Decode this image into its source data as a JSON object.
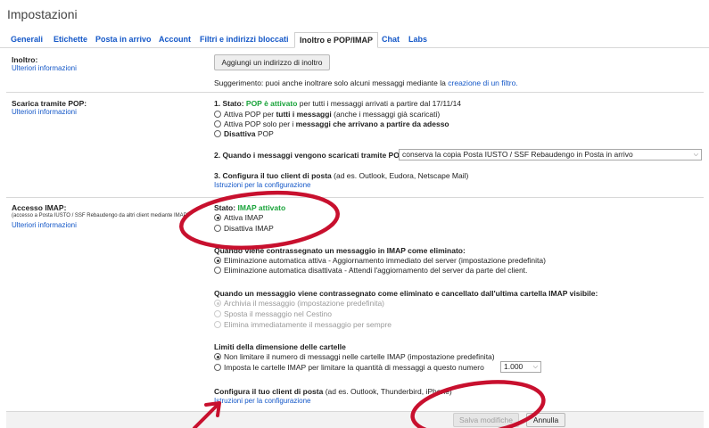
{
  "title": "Impostazioni",
  "tabs": [
    {
      "label": "Generali",
      "active": false
    },
    {
      "label": "Etichette",
      "active": false
    },
    {
      "label": "Posta in arrivo",
      "active": false
    },
    {
      "label": "Account",
      "active": false
    },
    {
      "label": "Filtri e indirizzi bloccati",
      "active": false
    },
    {
      "label": "Inoltro e POP/IMAP",
      "active": true
    },
    {
      "label": "Chat",
      "active": false
    },
    {
      "label": "Labs",
      "active": false
    }
  ],
  "forwarding": {
    "label": "Inoltro:",
    "learn_more": "Ulteriori informazioni",
    "add_button": "Aggiungi un indirizzo di inoltro",
    "tip_prefix": "Suggerimento: puoi anche inoltrare solo alcuni messaggi mediante la",
    "tip_link": "creazione di un filtro."
  },
  "pop": {
    "label": "Scarica tramite POP:",
    "learn_more": "Ulteriori informazioni",
    "status_prefix": "1. Stato:",
    "status_value": "POP è attivato",
    "status_suffix": "per tutti i messaggi arrivati a partire dal 17/11/14",
    "options": {
      "opt1_pre": "Attiva POP per",
      "opt1_bold": "tutti i messaggi",
      "opt1_post": "(anche i messaggi già scaricati)",
      "opt2_pre": "Attiva POP solo per i",
      "opt2_bold": "messaggi che arrivano a partire da adesso",
      "opt3_bold": "Disattiva",
      "opt3_post": "POP"
    },
    "when_accessed": "2. Quando i messaggi vengono scaricati tramite POP",
    "when_accessed_value": "conserva la copia Posta IUSTO / SSF Rebaudengo in Posta in arrivo",
    "configure_bold": "3. Configura il tuo client di posta",
    "configure_rest": "(ad es. Outlook, Eudora, Netscape Mail)",
    "configure_link": "Istruzioni per la configurazione"
  },
  "imap": {
    "label": "Accesso IMAP:",
    "sublabel": "(accesso a Posta IUSTO / SSF Rebaudengo da altri client mediante IMAP)",
    "learn_more": "Ulteriori informazioni",
    "status_prefix": "Stato:",
    "status_value": "IMAP attivato",
    "enable": "Attiva IMAP",
    "disable": "Disattiva IMAP",
    "deleted_heading": "Quando viene contrassegnato un messaggio in IMAP come eliminato:",
    "deleted_opt1": "Eliminazione automatica attiva - Aggiornamento immediato del server (impostazione predefinita)",
    "deleted_opt2": "Eliminazione automatica disattivata - Attendi l'aggiornamento del server da parte del client.",
    "expunged_heading": "Quando un messaggio viene contrassegnato come eliminato e cancellato dall'ultima cartella IMAP visibile:",
    "expunged_opt1": "Archivia il messaggio (impostazione predefinita)",
    "expunged_opt2": "Sposta il messaggio nel Cestino",
    "expunged_opt3": "Elimina immediatamente il messaggio per sempre",
    "folder_heading": "Limiti della dimensione delle cartelle",
    "folder_opt1": "Non limitare il numero di messaggi nelle cartelle IMAP (impostazione predefinita)",
    "folder_opt2": "Imposta le cartelle IMAP per limitare la quantità di messaggi a questo numero",
    "folder_limit_value": "1.000",
    "configure_bold": "Configura il tuo client di posta",
    "configure_rest": "(ad es. Outlook, Thunderbird, iPhone)",
    "configure_link": "Istruzioni per la configurazione"
  },
  "footer": {
    "save": "Salva modifiche",
    "cancel": "Annulla"
  },
  "colors": {
    "link": "#1558c8",
    "status_green": "#19a33a",
    "annotation_red": "#c8102e"
  },
  "icons": {
    "radio": "radio-button",
    "dropdown": "chevron-down-icon"
  }
}
